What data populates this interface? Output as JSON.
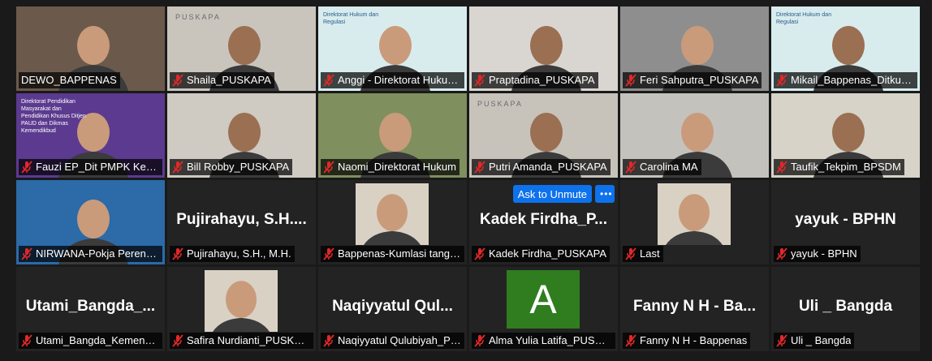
{
  "meeting": {
    "unmute_button": "Ask to Unmute",
    "more_button": "•••",
    "participants": [
      {
        "label": "DEWO_BAPPENAS",
        "muted": false,
        "video": true,
        "active": true,
        "bg": "#6b5a4c"
      },
      {
        "label": "Shaila_PUSKAPA",
        "muted": true,
        "video": true,
        "bg": "#c9c5bd",
        "watermark": "PUSKAPA"
      },
      {
        "label": "Anggi - Direktorat Hukum dan Regulasi",
        "muted": true,
        "video": true,
        "bg": "#d8ecee",
        "banner": "Direktorat Hukum dan Regulasi"
      },
      {
        "label": "Praptadina_PUSKAPA",
        "muted": true,
        "video": true,
        "bg": "#d9d6d2"
      },
      {
        "label": "Feri Sahputra_PUSKAPA",
        "muted": true,
        "video": true,
        "bg": "#8e8e8e"
      },
      {
        "label": "Mikail_Bappenas_Ditkumreg",
        "muted": true,
        "video": true,
        "bg": "#d8ecee",
        "banner": "Direktorat Hukum dan Regulasi"
      },
      {
        "label": "Fauzi EP_Dit PMPK Kemendikbud",
        "muted": true,
        "video": true,
        "bg": "#5b3a8f",
        "banner": "Direktorat Pendidikan Masyarakat dan Pendidikan Khusus Ditjen PAUD dan Dikmas Kemendikbud"
      },
      {
        "label": "Bill Robby_PUSKAPA",
        "muted": true,
        "video": true,
        "bg": "#cfcac2"
      },
      {
        "label": "Naomi_Direktorat Hukum",
        "muted": true,
        "video": true,
        "bg": "#7f8f5e"
      },
      {
        "label": "Putri Amanda_PUSKAPA",
        "muted": true,
        "video": true,
        "bg": "#c7c3bb",
        "watermark": "PUSKAPA"
      },
      {
        "label": "Carolina MA",
        "muted": true,
        "video": true,
        "bg": "#c4c2bd"
      },
      {
        "label": "Taufik_Tekpim_BPSDM",
        "muted": true,
        "video": true,
        "bg": "#d7d3c8"
      },
      {
        "label": "NIRWANA-Pokja Perencanaan",
        "muted": true,
        "video": true,
        "bg": "#2c6aa8"
      },
      {
        "label": "Pujirahayu, S.H., M.H.",
        "name": "Pujirahayu, S.H....",
        "muted": true,
        "video": false
      },
      {
        "label": "Bappenas-Kumlasi tangan",
        "muted": true,
        "video": true,
        "bg": "#232323",
        "photo": true
      },
      {
        "label": "Kadek Firdha_PUSKAPA",
        "name": "Kadek  Firdha_P...",
        "muted": true,
        "video": false,
        "unmute": true
      },
      {
        "label": "Last",
        "muted": true,
        "video": true,
        "bg": "#232323",
        "photo": true
      },
      {
        "label": "yayuk - BPHN",
        "name": "yayuk - BPHN",
        "muted": true,
        "video": false
      },
      {
        "label": "Utami_Bangda_Kemendagri",
        "name": "Utami_Bangda_...",
        "muted": true,
        "video": false
      },
      {
        "label": "Safira Nurdianti_PUSKAPA",
        "muted": true,
        "video": true,
        "bg": "#232323",
        "photo": true
      },
      {
        "label": "Naqiyyatul Qulubiyah_PUSKAPA",
        "name": "Naqiyyatul  Qul...",
        "muted": true,
        "video": false
      },
      {
        "label": "Alma Yulia Latifa_PUSKAPA",
        "muted": true,
        "video": false,
        "avatar": "A"
      },
      {
        "label": "Fanny N H - Bappenas",
        "name": "Fanny N H - Ba...",
        "muted": true,
        "video": false
      },
      {
        "label": "Uli _ Bangda",
        "name": "Uli _ Bangda",
        "muted": true,
        "video": false
      }
    ]
  }
}
